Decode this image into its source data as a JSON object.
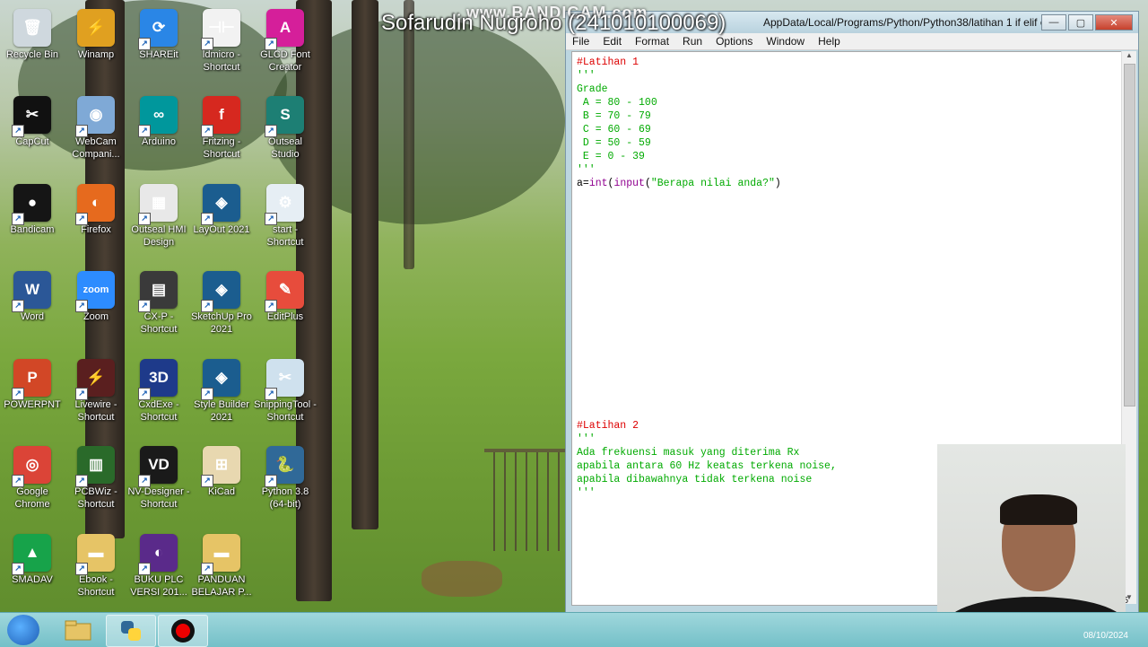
{
  "watermark": {
    "bandicam": "www.BANDICAM.com",
    "author": "Sofarudin Nugroho (241010100069)"
  },
  "desktop_icons": [
    {
      "label": "Recycle Bin",
      "icon": "recycle-bin-icon",
      "color": "#cfd8de",
      "glyph": "🗑"
    },
    {
      "label": "Winamp",
      "icon": "winamp-icon",
      "color": "#e0a020",
      "glyph": "⚡"
    },
    {
      "label": "SHAREit",
      "icon": "shareit-icon",
      "color": "#2a86e6",
      "glyph": "⟳"
    },
    {
      "label": "ldmicro - Shortcut",
      "icon": "ldmicro-icon",
      "color": "#f2f2f2",
      "glyph": "⊣⊢"
    },
    {
      "label": "GLCD Font Creator",
      "icon": "glcd-icon",
      "color": "#d51f9a",
      "glyph": "A"
    },
    {
      "label": "CapCut",
      "icon": "capcut-icon",
      "color": "#111111",
      "glyph": "✂"
    },
    {
      "label": "WebCam Compani...",
      "icon": "webcam-icon",
      "color": "#7fa9d6",
      "glyph": "◉"
    },
    {
      "label": "Arduino",
      "icon": "arduino-icon",
      "color": "#00979c",
      "glyph": "∞"
    },
    {
      "label": "Fritzing - Shortcut",
      "icon": "fritzing-icon",
      "color": "#d6281f",
      "glyph": "f"
    },
    {
      "label": "Outseal Studio",
      "icon": "outseal-studio-icon",
      "color": "#1d7f74",
      "glyph": "S"
    },
    {
      "label": "Bandicam",
      "icon": "bandicam-icon",
      "color": "#151515",
      "glyph": "●"
    },
    {
      "label": "Firefox",
      "icon": "firefox-icon",
      "color": "#e66a1e",
      "glyph": "◐"
    },
    {
      "label": "Outseal HMI Design",
      "icon": "outseal-hmi-icon",
      "color": "#e8e8e8",
      "glyph": "▦"
    },
    {
      "label": "LayOut 2021",
      "icon": "layout-icon",
      "color": "#1b5d8f",
      "glyph": "◈"
    },
    {
      "label": "start - Shortcut",
      "icon": "start-icon",
      "color": "#e6eef4",
      "glyph": "⚙"
    },
    {
      "label": "Word",
      "icon": "word-icon",
      "color": "#2b5797",
      "glyph": "W"
    },
    {
      "label": "Zoom",
      "icon": "zoom-icon",
      "color": "#2d8cff",
      "glyph": "zoom"
    },
    {
      "label": "CX-P - Shortcut",
      "icon": "cx-p-icon",
      "color": "#3a3a3a",
      "glyph": "▤"
    },
    {
      "label": "SketchUp Pro 2021",
      "icon": "sketchup-icon",
      "color": "#1b5d8f",
      "glyph": "◈"
    },
    {
      "label": "EditPlus",
      "icon": "editplus-icon",
      "color": "#e74c3c",
      "glyph": "✎"
    },
    {
      "label": "POWERPNT",
      "icon": "powerpoint-icon",
      "color": "#d24726",
      "glyph": "P"
    },
    {
      "label": "Livewire - Shortcut",
      "icon": "livewire-icon",
      "color": "#5a1f1f",
      "glyph": "⚡"
    },
    {
      "label": "CxdExe - Shortcut",
      "icon": "cxdexe-icon",
      "color": "#1e3a8a",
      "glyph": "3D"
    },
    {
      "label": "Style Builder 2021",
      "icon": "style-builder-icon",
      "color": "#1b5d8f",
      "glyph": "◈"
    },
    {
      "label": "SnippingTool - Shortcut",
      "icon": "snipping-tool-icon",
      "color": "#cfe1ee",
      "glyph": "✂"
    },
    {
      "label": "Google Chrome",
      "icon": "chrome-icon",
      "color": "#db4437",
      "glyph": "◎"
    },
    {
      "label": "PCBWiz - Shortcut",
      "icon": "pcbwiz-icon",
      "color": "#2a6a2a",
      "glyph": "▥"
    },
    {
      "label": "NV-Designer - Shortcut",
      "icon": "nv-designer-icon",
      "color": "#1a1a1a",
      "glyph": "VD"
    },
    {
      "label": "KiCad",
      "icon": "kicad-icon",
      "color": "#e8d8b0",
      "glyph": "⊞"
    },
    {
      "label": "Python 3.8 (64-bit)",
      "icon": "python-icon",
      "color": "#306998",
      "glyph": "🐍"
    },
    {
      "label": "SMADAV",
      "icon": "smadav-icon",
      "color": "#17a34a",
      "glyph": "▲"
    },
    {
      "label": "Ebook - Shortcut",
      "icon": "folder-icon",
      "color": "#e6c466",
      "glyph": "▬"
    },
    {
      "label": "BUKU PLC VERSI 201...",
      "icon": "firefox-doc-icon",
      "color": "#5a2a8a",
      "glyph": "◐"
    },
    {
      "label": "PANDUAN BELAJAR P...",
      "icon": "folder-icon",
      "color": "#e6c466",
      "glyph": "▬"
    }
  ],
  "idle_window": {
    "title": "AppData/Local/Programs/Python/Python38/latihan 1 if elif el...",
    "buttons": {
      "minimize": "—",
      "maximize": "▢",
      "close": "✕"
    },
    "menu": [
      "File",
      "Edit",
      "Format",
      "Run",
      "Options",
      "Window",
      "Help"
    ],
    "code_block_1": {
      "comment": "#Latihan 1",
      "docstring": "'''\nGrade\n A = 80 - 100\n B = 70 - 79\n C = 60 - 69\n D = 50 - 59\n E = 0 - 39\n'''",
      "assign_prefix": "a=",
      "builtin_int": "int",
      "paren_open": "(",
      "builtin_input": "input",
      "paren_open2": "(",
      "prompt_string": "\"Berapa nilai anda?\"",
      "paren_close": ")"
    },
    "code_block_2": {
      "comment": "#Latihan 2",
      "docstring": "'''\nAda frekuensi masuk yang diterima Rx\napabila antara 60 Hz keatas terkena noise,\napabila dibawahnya tidak terkena noise\n'''"
    }
  },
  "taskbar": {
    "clock_date": "08/10/2024",
    "items": [
      "windows-explorer-icon",
      "python-idle-icon",
      "bandicam-icon"
    ]
  },
  "status_line": "5"
}
